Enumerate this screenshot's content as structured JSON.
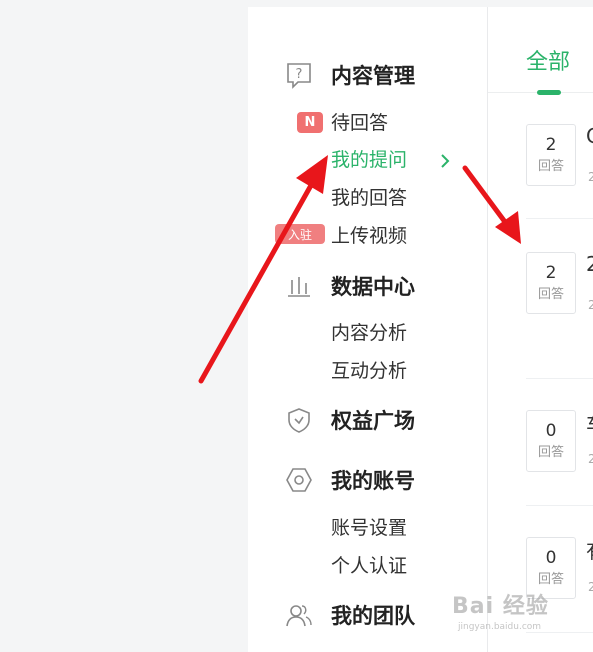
{
  "sidebar": {
    "sections": [
      {
        "title": "内容管理",
        "icon": "question-doc-icon"
      },
      {
        "title": "数据中心",
        "icon": "bar-chart-icon"
      },
      {
        "title": "权益广场",
        "icon": "shield-check-icon"
      },
      {
        "title": "我的账号",
        "icon": "hexagon-settings-icon"
      },
      {
        "title": "我的团队",
        "icon": "team-users-icon"
      }
    ],
    "items": {
      "pending_answers": "待回答",
      "my_questions": "我的提问",
      "my_answers": "我的回答",
      "upload_video": "上传视频",
      "content_analysis": "内容分析",
      "interaction_analysis": "互动分析",
      "account_settings": "账号设置",
      "personal_verification": "个人认证"
    },
    "badges": {
      "pending_answers_badge": "N",
      "upload_video_badge": "入驻"
    },
    "active_item": "my_questions"
  },
  "main": {
    "tab_all": "全部",
    "questions": [
      {
        "count": "2",
        "count_label": "回答",
        "title_peek": "C",
        "sub_peek": "2"
      },
      {
        "count": "2",
        "count_label": "回答",
        "title_peek": "2",
        "sub_peek": "2"
      },
      {
        "count": "0",
        "count_label": "回答",
        "title_peek": "车",
        "sub_peek": "2"
      },
      {
        "count": "0",
        "count_label": "回答",
        "title_peek": "有",
        "sub_peek": "2"
      }
    ]
  },
  "watermark": {
    "main": "Bai 经验",
    "url": "jingyan.baidu.com"
  },
  "colors": {
    "accent": "#2bb36a",
    "badge": "#f07070",
    "annotation_arrow": "#e8161b"
  }
}
